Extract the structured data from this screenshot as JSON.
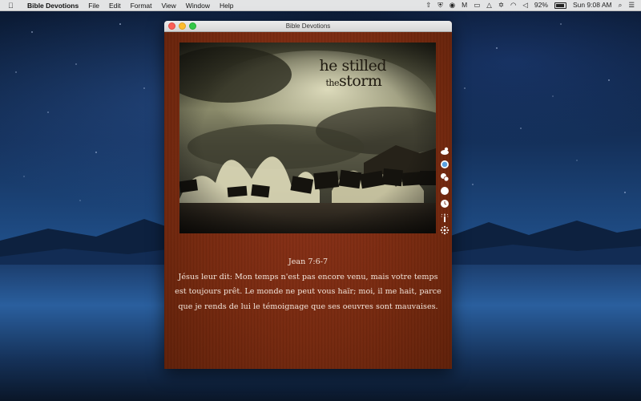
{
  "menubar": {
    "app_name": "Bible Devotions",
    "menus": [
      "File",
      "Edit",
      "Format",
      "View",
      "Window",
      "Help"
    ],
    "battery_percent": "92%",
    "battery_level": 0.92,
    "clock": "Sun 9:08 AM"
  },
  "window": {
    "title": "Bible Devotions",
    "image_caption_line1_big": "he",
    "image_caption_line1": "stilled",
    "image_caption_line2_small": "the",
    "image_caption_line2": "storm"
  },
  "verse": {
    "reference": "Jean 7:6-7",
    "text": "Jésus leur dit: Mon temps n'est pas encore venu, mais votre temps est toujours prêt. Le monde ne peut vous haïr; moi, il me hait, parce que je rends de lui le témoignage que ses oeuvres sont mauvaises."
  },
  "sidebar_icons": [
    "cloud-sun-icon",
    "circle-filled-icon",
    "chat-bubbles-icon",
    "white-circle-icon",
    "clock-icon",
    "candle-icon",
    "settings-icon"
  ],
  "colors": {
    "window_background": "#7a2b16",
    "verse_text": "#f3e6dc",
    "desktop_top": "#0a1830"
  }
}
